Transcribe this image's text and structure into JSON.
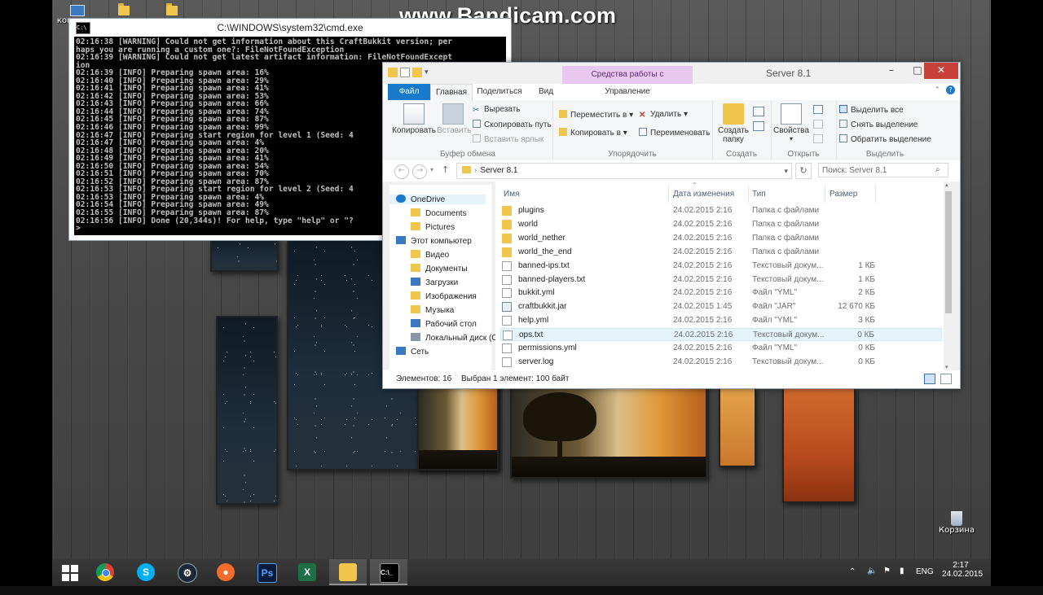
{
  "watermark": "www.Bandicam.com",
  "desktop": {
    "recycle_bin_label": "Корзина",
    "partial_icon_label": "компь"
  },
  "cmd": {
    "title": "C:\\WINDOWS\\system32\\cmd.exe",
    "icon_text": "C:\\",
    "lines": [
      "02:16:38 [WARNING] Could not get information about this CraftBukkit version; per",
      "haps you are running a custom one?: FileNotFoundException",
      "02:16:39 [WARNING] Could not get latest artifact information: FileNotFoundExcept",
      "ion",
      "02:16:39 [INFO] Preparing spawn area: 16%",
      "02:16:40 [INFO] Preparing spawn area: 29%",
      "02:16:41 [INFO] Preparing spawn area: 41%",
      "02:16:42 [INFO] Preparing spawn area: 53%",
      "02:16:43 [INFO] Preparing spawn area: 66%",
      "02:16:44 [INFO] Preparing spawn area: 74%",
      "02:16:45 [INFO] Preparing spawn area: 87%",
      "02:16:46 [INFO] Preparing spawn area: 99%",
      "02:16:47 [INFO] Preparing start region for level 1 (Seed: 4",
      "02:16:47 [INFO] Preparing spawn area: 4%",
      "02:16:48 [INFO] Preparing spawn area: 20%",
      "02:16:49 [INFO] Preparing spawn area: 41%",
      "02:16:50 [INFO] Preparing spawn area: 54%",
      "02:16:51 [INFO] Preparing spawn area: 70%",
      "02:16:52 [INFO] Preparing spawn area: 87%",
      "02:16:53 [INFO] Preparing start region for level 2 (Seed: 4",
      "02:16:53 [INFO] Preparing spawn area: 4%",
      "02:16:54 [INFO] Preparing spawn area: 49%",
      "02:16:55 [INFO] Preparing spawn area: 87%",
      "02:16:56 [INFO] Done (20,344s)! For help, type \"help\" or \"?",
      ">"
    ]
  },
  "explorer": {
    "title": "Server 8.1",
    "contextual_tab": "Средства работы с приложениями",
    "tabs": {
      "file": "Файл",
      "home": "Главная",
      "share": "Поделиться",
      "view": "Вид",
      "manage": "Управление"
    },
    "ribbon": {
      "copy": "Копировать",
      "paste": "Вставить",
      "cut": "Вырезать",
      "copy_path": "Скопировать путь",
      "paste_shortcut": "Вставить ярлык",
      "clipboard_group": "Буфер обмена",
      "move_to": "Переместить в",
      "copy_to": "Копировать в",
      "delete": "Удалить",
      "rename": "Переименовать",
      "organize_group": "Упорядочить",
      "new_folder_line1": "Создать",
      "new_folder_line2": "папку",
      "new_group": "Создать",
      "properties": "Свойства",
      "open_group": "Открыть",
      "select_all": "Выделить все",
      "select_none": "Снять выделение",
      "invert_selection": "Обратить выделение",
      "select_group": "Выделить"
    },
    "address": "Server 8.1",
    "search_placeholder": "Поиск: Server 8.1",
    "nav": {
      "onedrive": "OneDrive",
      "documents": "Documents",
      "pictures": "Pictures",
      "this_pc": "Этот компьютер",
      "video": "Видео",
      "docs_ru": "Документы",
      "downloads": "Загрузки",
      "images": "Изображения",
      "music": "Музыка",
      "desktop": "Рабочий стол",
      "local_disk": "Локальный диск (C",
      "network": "Сеть"
    },
    "columns": {
      "name": "Имя",
      "date": "Дата изменения",
      "type": "Тип",
      "size": "Размер"
    },
    "files": [
      {
        "name": "plugins",
        "date": "24.02.2015 2:16",
        "type": "Папка с файлами",
        "size": ""
      },
      {
        "name": "world",
        "date": "24.02.2015 2:16",
        "type": "Папка с файлами",
        "size": ""
      },
      {
        "name": "world_nether",
        "date": "24.02.2015 2:16",
        "type": "Папка с файлами",
        "size": ""
      },
      {
        "name": "world_the_end",
        "date": "24.02.2015 2:16",
        "type": "Папка с файлами",
        "size": ""
      },
      {
        "name": "banned-ips.txt",
        "date": "24.02.2015 2:16",
        "type": "Текстовый докум...",
        "size": "1 КБ"
      },
      {
        "name": "banned-players.txt",
        "date": "24.02.2015 2:16",
        "type": "Текстовый докум...",
        "size": "1 КБ"
      },
      {
        "name": "bukkit.yml",
        "date": "24.02.2015 2:16",
        "type": "Файл \"YML\"",
        "size": "2 КБ"
      },
      {
        "name": "craftbukkit.jar",
        "date": "24.02.2015 1:45",
        "type": "Файл \"JAR\"",
        "size": "12 670 КБ"
      },
      {
        "name": "help.yml",
        "date": "24.02.2015 2:16",
        "type": "Файл \"YML\"",
        "size": "3 КБ"
      },
      {
        "name": "ops.txt",
        "date": "24.02.2015 2:16",
        "type": "Текстовый докум...",
        "size": "0 КБ"
      },
      {
        "name": "permissions.yml",
        "date": "24.02.2015 2:16",
        "type": "Файл \"YML\"",
        "size": "0 КБ"
      },
      {
        "name": "server.log",
        "date": "24.02.2015 2:16",
        "type": "Текстовый докум...",
        "size": "0 КБ"
      }
    ],
    "status_items": "Элементов: 16",
    "status_selected": "Выбран 1 элемент: 100 байт"
  },
  "taskbar": {
    "apps": [
      "windows-logo",
      "chrome",
      "skype",
      "steam",
      "origin",
      "photoshop",
      "excel",
      "file-explorer",
      "cmd"
    ],
    "ps_text": "Ps",
    "xl_text": "X",
    "lang": "ENG",
    "time": "2:17",
    "date": "24.02.2015"
  },
  "colors": {
    "ribbon_file_tab": "#1979ca",
    "contextual_tab_bg": "#e8c8ee",
    "close_button": "#c7413a",
    "selection": "#e5f3fb"
  }
}
